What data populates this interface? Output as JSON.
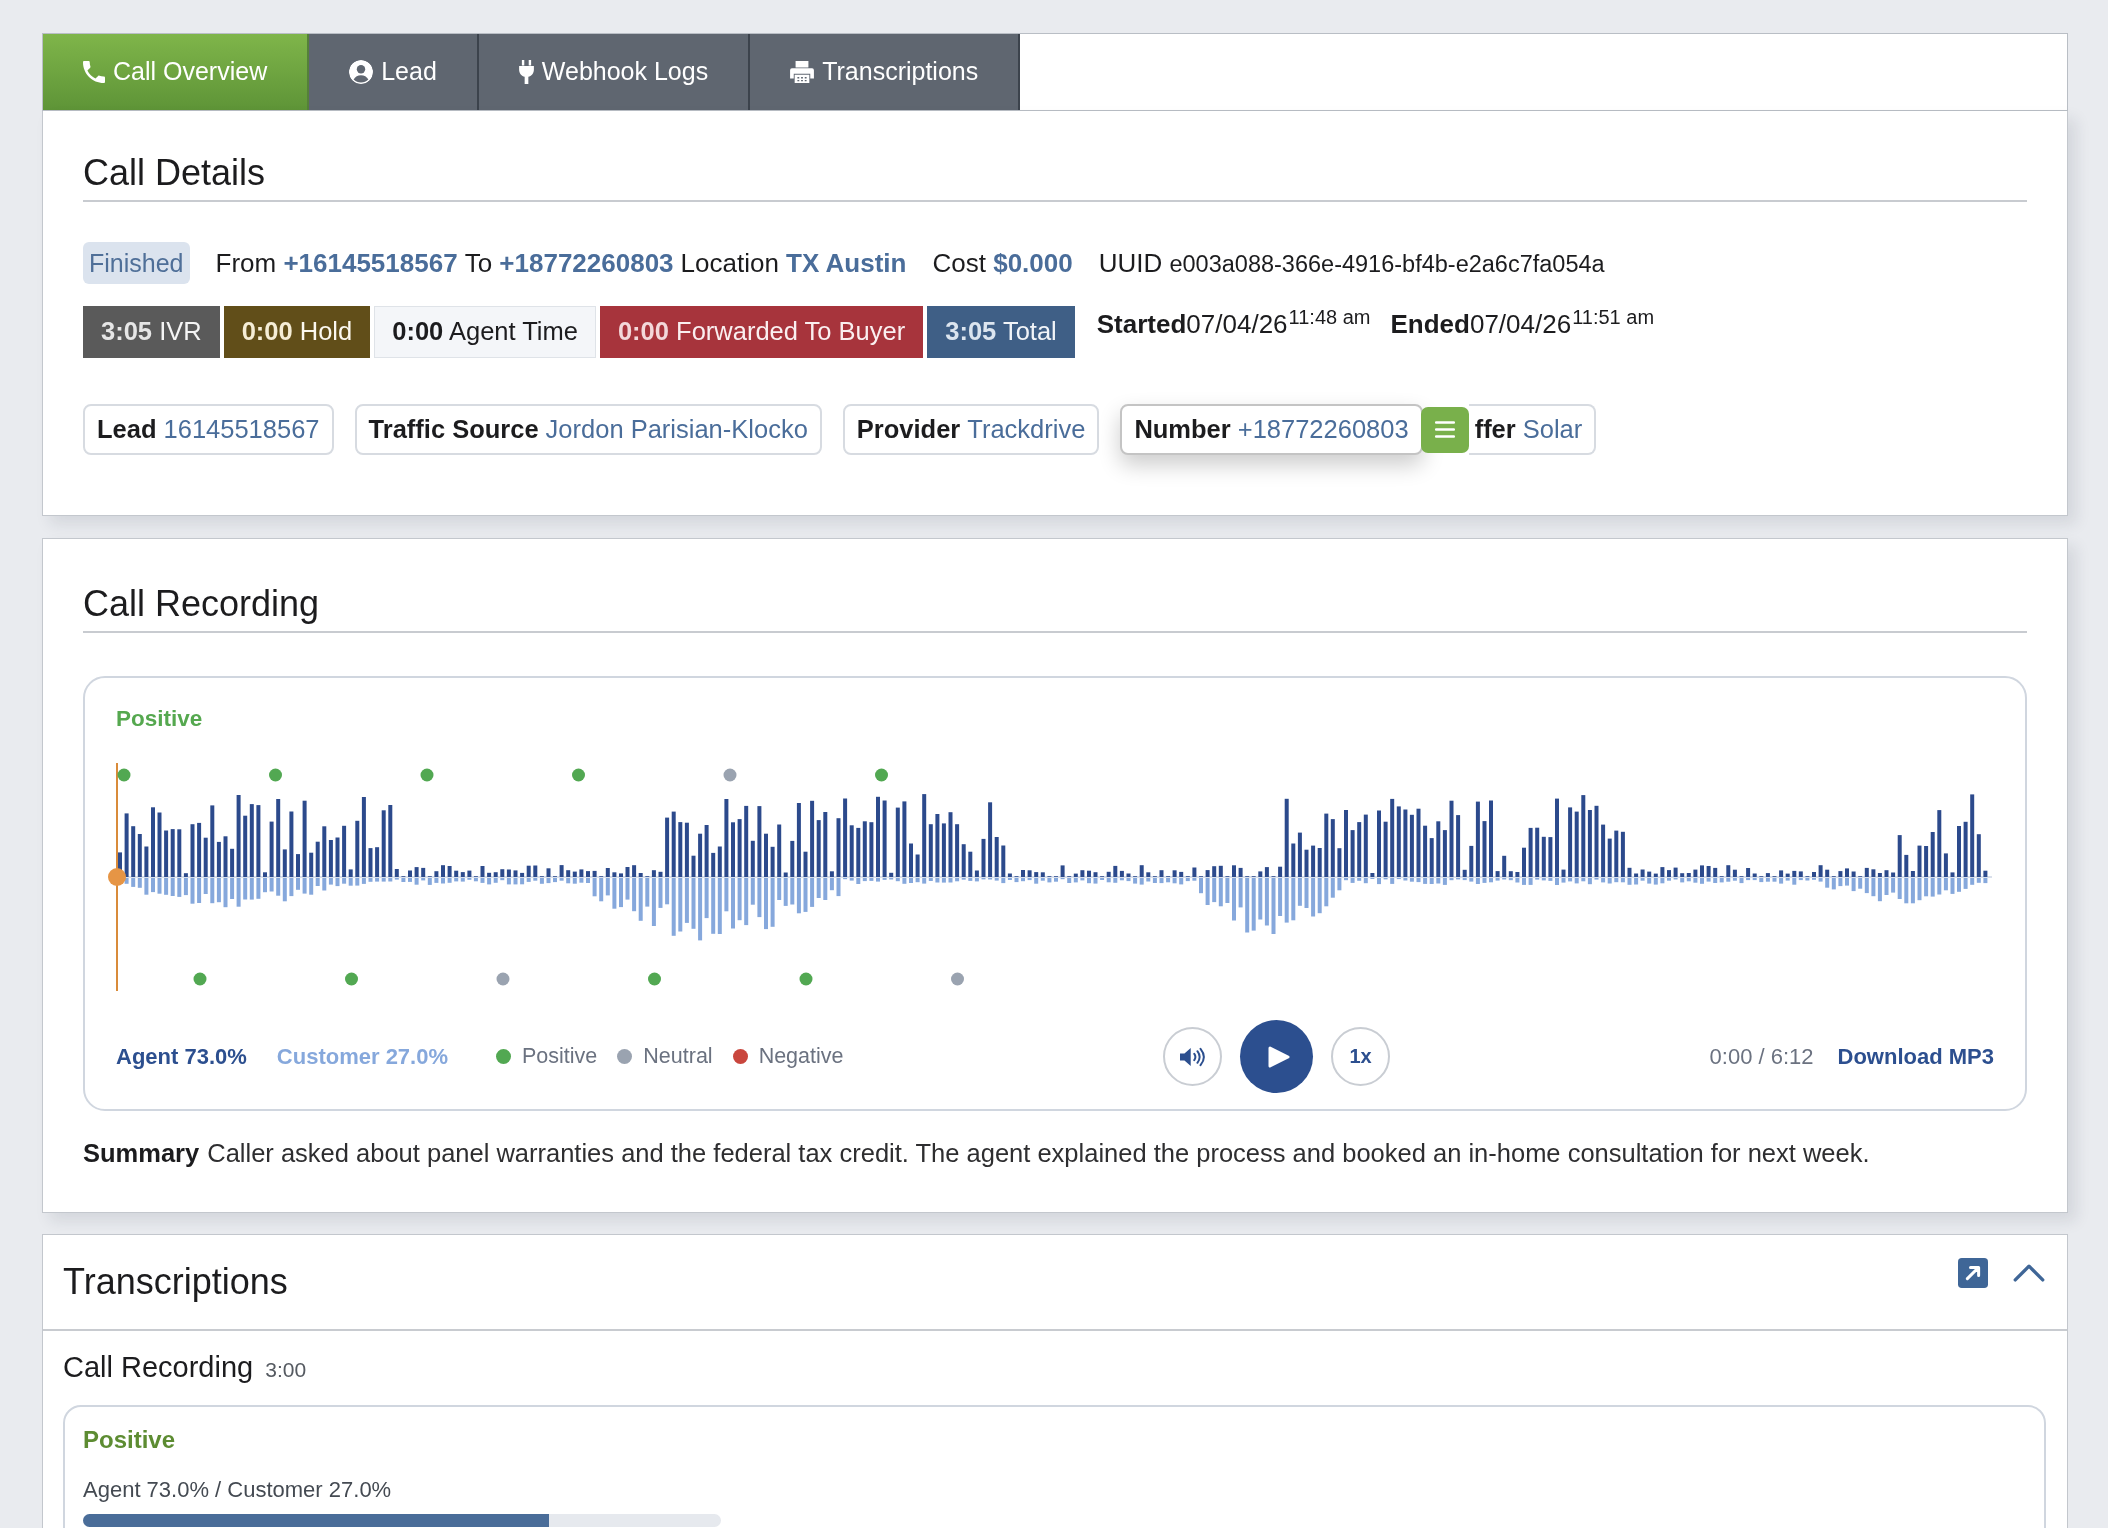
{
  "tabs": [
    {
      "label": "Call Overview",
      "selected": true
    },
    {
      "label": "Lead",
      "selected": false
    },
    {
      "label": "Webhook Logs",
      "selected": false
    },
    {
      "label": "Transcriptions",
      "selected": false
    }
  ],
  "call_details": {
    "title": "Call Details",
    "status": "Finished",
    "details": [
      {
        "fields": [
          {
            "label": "From",
            "value": "+16145518567",
            "kind": "link"
          },
          {
            "label": "To",
            "value": "+18772260803",
            "kind": "link"
          },
          {
            "label": "Location",
            "value": "TX Austin",
            "kind": "link"
          }
        ]
      },
      {
        "fields": [
          {
            "label": "Cost",
            "value": "$0.000",
            "kind": "link"
          }
        ]
      },
      {
        "fields": [
          {
            "label": "UUID",
            "value": "e003a088-366e-4916-bf4b-e2a6c7fa054a",
            "kind": "text"
          }
        ]
      }
    ],
    "timings": [
      {
        "text": "**3:05** IVR",
        "color": "#5a5a5a"
      },
      {
        "text": "**0:00** Hold",
        "color": "#614e19"
      },
      {
        "text": "**0:00** Agent Time",
        "color": "#f4f6f9"
      },
      {
        "text": "**0:00** Forwarded To Buyer",
        "color": "#a7343c"
      },
      {
        "text": "**3:05** Total",
        "color": "#3f5f86"
      }
    ],
    "timestamps": [
      {
        "label": "Started",
        "date": "07/04/26",
        "time": "11:48 am"
      },
      {
        "label": "Ended",
        "date": "07/04/26",
        "time": "11:51 am"
      }
    ],
    "tags": [
      {
        "label": "Lead",
        "value": "16145518567",
        "dragging": false
      },
      {
        "label": "Traffic Source",
        "value": "Jordon Parisian-Klocko",
        "dragging": false
      },
      {
        "label": "Provider",
        "value": "Trackdrive",
        "dragging": false
      },
      {
        "label": "Number",
        "value": "+18772260803",
        "dragging": true
      },
      {
        "label": "ffer",
        "value": "Solar",
        "dragging": false
      }
    ]
  },
  "recording": {
    "title": "Call Recording",
    "sentiment": "Positive",
    "agent_markers": [
      {
        "color": "#52a852"
      },
      {
        "color": "#52a852"
      },
      {
        "color": "#52a852"
      },
      {
        "color": "#52a852"
      },
      {
        "color": "#9aa3b0"
      },
      {
        "color": "#52a852"
      }
    ],
    "customer_markers": [
      {
        "color": "#52a852"
      },
      {
        "color": "#52a852"
      },
      {
        "color": "#9aa3b0"
      },
      {
        "color": "#52a852"
      },
      {
        "color": "#52a852"
      },
      {
        "color": "#9aa3b0"
      }
    ],
    "agent_share": "Agent 73.0%",
    "customer_share": "Customer 27.0%",
    "legend": [
      {
        "label": "Positive",
        "color": "#52a852"
      },
      {
        "label": "Neutral",
        "color": "#9aa3b0"
      },
      {
        "label": "Negative",
        "color": "#c9463d"
      }
    ],
    "speed": "1x",
    "time": "0:00 / 6:12",
    "download": "Download MP3",
    "summary_label": "Summary",
    "summary": "Caller asked about panel warranties and the federal tax credit. The agent explained the process and booked an in-home consultation for next week."
  },
  "transcriptions": {
    "title": "Transcriptions",
    "expanded": true,
    "recordings": [
      {
        "title": "Call Recording",
        "duration": "3:00",
        "sentiment": "Positive",
        "split": "Agent 73.0% / Customer 27.0%",
        "level": 0.73
      }
    ]
  }
}
